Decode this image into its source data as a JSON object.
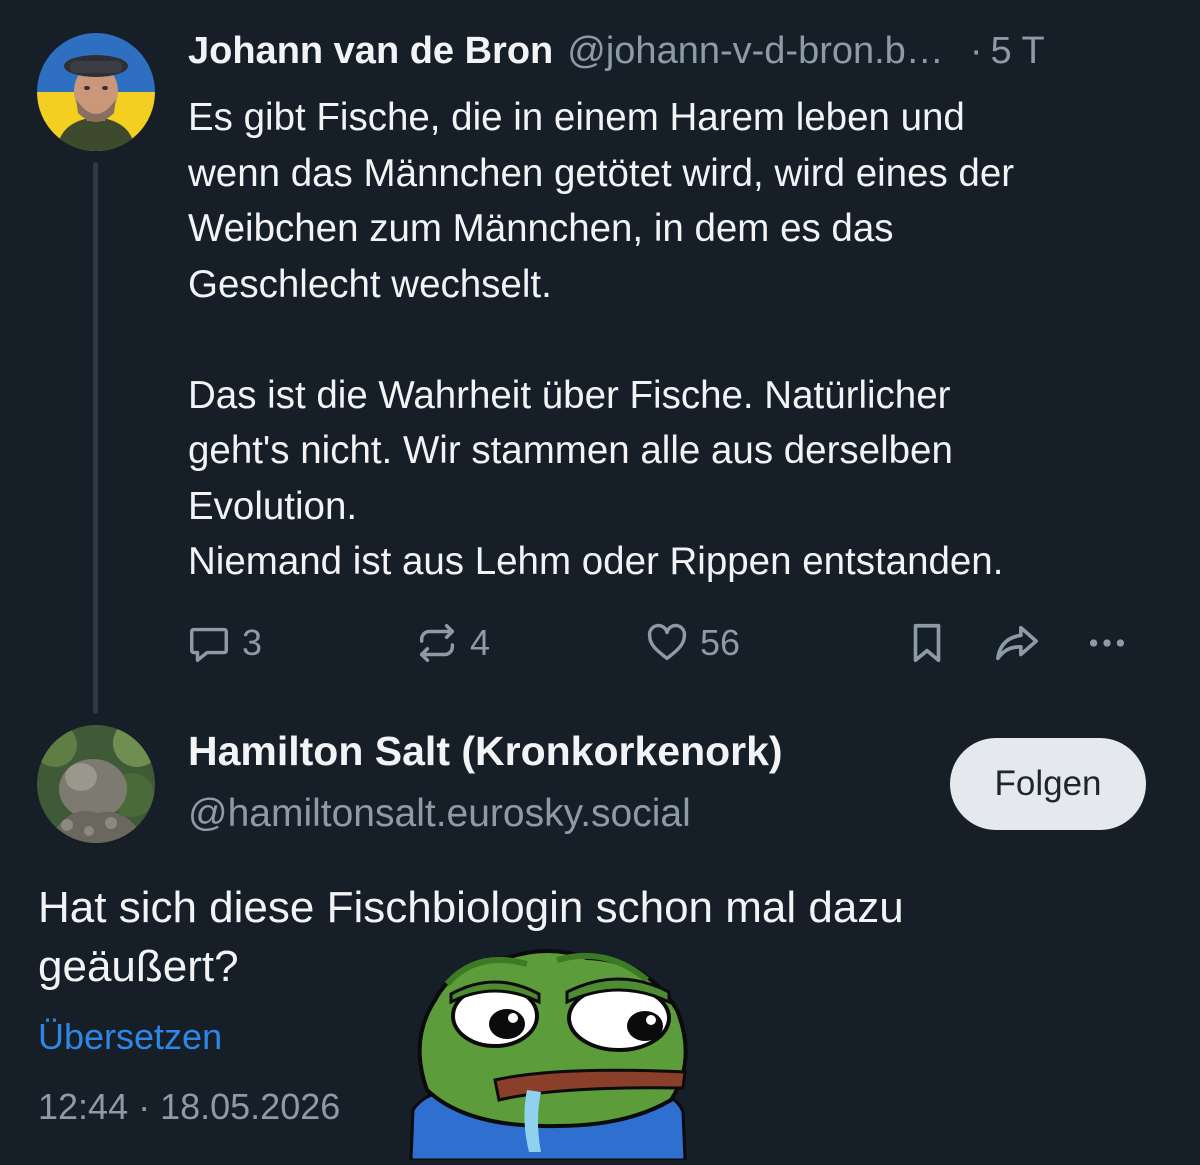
{
  "post1": {
    "author": "Johann van de Bron",
    "handle": "@johann-v-d-bron.b…",
    "separator": "·",
    "time": "5 T",
    "text": "Es gibt Fische, die in einem Harem leben und\nwenn das Männchen getötet wird, wird eines der\nWeibchen zum Männchen, in dem es das\nGeschlecht wechselt.\n\nDas ist die Wahrheit über Fische. Natürlicher\ngeht's nicht. Wir stammen alle aus derselben\nEvolution.\nNiemand ist aus Lehm oder Rippen entstanden.",
    "actions": {
      "replies": "3",
      "reposts": "4",
      "likes": "56"
    },
    "icons": [
      "reply-icon",
      "repost-icon",
      "like-icon",
      "bookmark-icon",
      "share-icon",
      "more-icon"
    ]
  },
  "post2": {
    "author": "Hamilton Salt (Kronkorkenork)",
    "handle": "@hamiltonsalt.eurosky.social",
    "follow_label": "Folgen",
    "text": "Hat sich diese Fischbiologin schon mal dazu geäußert?",
    "translate_label": "Übersetzen",
    "timestamp": "12:44 · 18.05.2026"
  },
  "colors": {
    "background": "#161e27",
    "text": "#f1f3f5",
    "muted": "#8d9aa8",
    "link": "#2f86e5",
    "button_bg": "#e5e8ec"
  }
}
